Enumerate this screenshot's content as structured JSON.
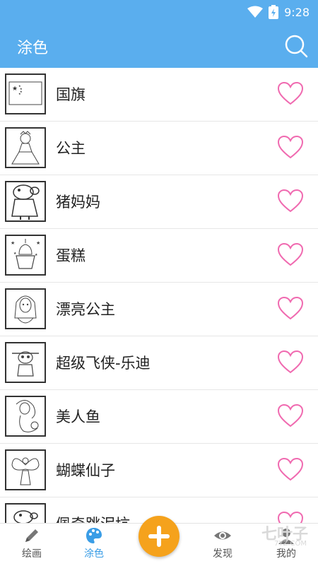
{
  "status_bar": {
    "time": "9:28"
  },
  "app_bar": {
    "title": "涂色"
  },
  "items": [
    {
      "label": "国旗"
    },
    {
      "label": "公主"
    },
    {
      "label": "猪妈妈"
    },
    {
      "label": "蛋糕"
    },
    {
      "label": "漂亮公主"
    },
    {
      "label": "超级飞侠-乐迪"
    },
    {
      "label": "美人鱼"
    },
    {
      "label": "蝴蝶仙子"
    },
    {
      "label": "佩奇跳泥坑"
    }
  ],
  "bottom_nav": {
    "draw_label": "绘画",
    "color_label": "涂色",
    "discover_label": "发现",
    "mine_label": "我的"
  },
  "watermark": {
    "main": "七叶子",
    "sub": "7YZ.COM"
  },
  "colors": {
    "primary": "#5aaeee",
    "fab": "#f5a21c",
    "heart": "#f06ab0",
    "active": "#3a9de6"
  }
}
